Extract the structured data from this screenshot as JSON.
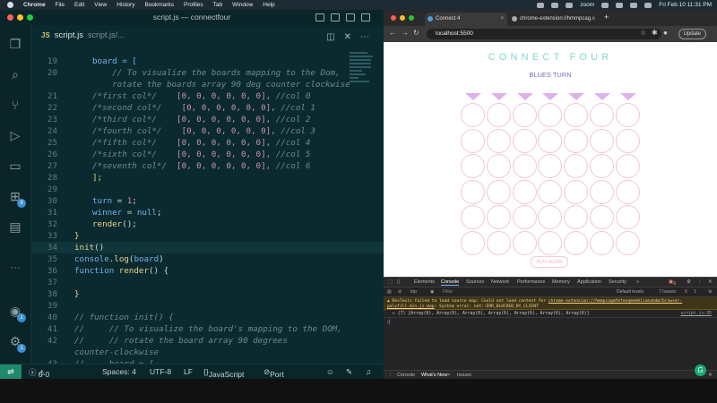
{
  "menubar": {
    "app": "Chrome",
    "items": [
      "File",
      "Edit",
      "View",
      "History",
      "Bookmarks",
      "Profiles",
      "Tab",
      "Window",
      "Help"
    ],
    "zoom": "zoom",
    "datetime": "Fri Feb 10  11:31 PM"
  },
  "vscode": {
    "title": "script.js — connectfour",
    "tab": {
      "icon": "JS",
      "name": "script.js",
      "path": "script.js/..."
    },
    "lines": [
      {
        "n": "19",
        "segs": [
          {
            "t": "board = [",
            "c": "vr"
          }
        ]
      },
      {
        "n": "20",
        "segs": [
          {
            "t": "    // To visualize the boards mapping to the Dom,",
            "c": "cm"
          }
        ]
      },
      {
        "n": "",
        "segs": [
          {
            "t": "    rotate the boards array 90 deg counter clockwise",
            "c": "cm"
          }
        ]
      },
      {
        "n": "21",
        "segs": [
          {
            "t": "/*first col*/    ",
            "c": "cm"
          },
          {
            "t": "[0, 0, 0, 0, 0, 0],",
            "c": "nm"
          },
          {
            "t": " //col 0",
            "c": "cm"
          }
        ]
      },
      {
        "n": "22",
        "segs": [
          {
            "t": "/*second col*/    ",
            "c": "cm"
          },
          {
            "t": "[0, 0, 0, 0, 0, 0],",
            "c": "nm"
          },
          {
            "t": " //col 1",
            "c": "cm"
          }
        ]
      },
      {
        "n": "23",
        "segs": [
          {
            "t": "/*third col*/    ",
            "c": "cm"
          },
          {
            "t": "[0, 0, 0, 0, 0, 0],",
            "c": "nm"
          },
          {
            "t": " //col 2",
            "c": "cm"
          }
        ]
      },
      {
        "n": "24",
        "segs": [
          {
            "t": "/*fourth col*/    ",
            "c": "cm"
          },
          {
            "t": "[0, 0, 0, 0, 0, 0],",
            "c": "nm"
          },
          {
            "t": " //col 3",
            "c": "cm"
          }
        ]
      },
      {
        "n": "25",
        "segs": [
          {
            "t": "/*fifth col*/    ",
            "c": "cm"
          },
          {
            "t": "[0, 0, 0, 0, 0, 0],",
            "c": "nm"
          },
          {
            "t": " //col 4",
            "c": "cm"
          }
        ]
      },
      {
        "n": "26",
        "segs": [
          {
            "t": "/*sixth col*/    ",
            "c": "cm"
          },
          {
            "t": "[0, 0, 0, 0, 0, 0],",
            "c": "nm"
          },
          {
            "t": " //col 5",
            "c": "cm"
          }
        ]
      },
      {
        "n": "27",
        "segs": [
          {
            "t": "/*seventh col*/  ",
            "c": "cm"
          },
          {
            "t": "[0, 0, 0, 0, 0, 0],",
            "c": "nm"
          },
          {
            "t": " //col 6",
            "c": "cm"
          }
        ]
      },
      {
        "n": "28",
        "segs": [
          {
            "t": "];",
            "c": "pn"
          }
        ]
      },
      {
        "n": "29",
        "segs": []
      },
      {
        "n": "30",
        "segs": [
          {
            "t": "turn",
            "c": "vr"
          },
          {
            "t": " = ",
            "c": ""
          },
          {
            "t": "1",
            "c": "nm"
          },
          {
            "t": ";",
            "c": ""
          }
        ]
      },
      {
        "n": "31",
        "segs": [
          {
            "t": "winner",
            "c": "vr"
          },
          {
            "t": " = ",
            "c": ""
          },
          {
            "t": "null",
            "c": "kw"
          },
          {
            "t": ";",
            "c": ""
          }
        ]
      },
      {
        "n": "32",
        "segs": [
          {
            "t": "render",
            "c": "fn"
          },
          {
            "t": "();",
            "c": ""
          }
        ]
      },
      {
        "n": "33",
        "segs": [
          {
            "t": "}",
            "c": "pn"
          }
        ]
      },
      {
        "n": "34",
        "segs": [
          {
            "t": "init",
            "c": "fn"
          },
          {
            "t": "()",
            "c": ""
          }
        ]
      },
      {
        "n": "35",
        "segs": [
          {
            "t": "console",
            "c": "vr"
          },
          {
            "t": ".",
            "c": ""
          },
          {
            "t": "log",
            "c": "fn"
          },
          {
            "t": "(",
            "c": ""
          },
          {
            "t": "board",
            "c": "vr"
          },
          {
            "t": ")",
            "c": ""
          }
        ]
      },
      {
        "n": "36",
        "segs": [
          {
            "t": "function ",
            "c": "kw"
          },
          {
            "t": "render",
            "c": "fn"
          },
          {
            "t": "() {",
            "c": ""
          }
        ]
      },
      {
        "n": "37",
        "segs": []
      },
      {
        "n": "38",
        "segs": [
          {
            "t": "}",
            "c": "pn"
          }
        ]
      },
      {
        "n": "39",
        "segs": []
      },
      {
        "n": "40",
        "segs": [
          {
            "t": "// function init() {",
            "c": "cm"
          }
        ]
      },
      {
        "n": "41",
        "segs": [
          {
            "t": "//     // To visualize the board's mapping to the DOM,",
            "c": "cm"
          }
        ]
      },
      {
        "n": "42",
        "segs": [
          {
            "t": "//     // rotate the board array 90 degrees",
            "c": "cm"
          }
        ]
      },
      {
        "n": "",
        "segs": [
          {
            "t": "counter-clockwise",
            "c": "cm"
          }
        ]
      },
      {
        "n": "43",
        "segs": [
          {
            "t": "//     board = [",
            "c": "cm"
          }
        ]
      }
    ],
    "status": {
      "errors": "0",
      "warnings": "0",
      "spaces": "Spaces: 4",
      "encoding": "UTF-8",
      "eol": "LF",
      "language": "JavaScript",
      "port": "Port : 5500"
    },
    "badges": {
      "extensions": "8",
      "accounts": "1",
      "settings": "1"
    }
  },
  "chrome": {
    "tabs": [
      {
        "title": "Connect 4"
      },
      {
        "title": "chrome-extension://hmmpcag..."
      }
    ],
    "url": "localhost:5500",
    "update": "Update",
    "game": {
      "title": "CONNECT FOUR",
      "turn": "BLUES TURN",
      "play_again": "PLAY AGAIN",
      "columns": 7,
      "rows": 6
    },
    "devtools": {
      "tabs": [
        "Elements",
        "Console",
        "Sources",
        "Network",
        "Performance",
        "Memory",
        "Application",
        "Security"
      ],
      "active": "Console",
      "filter": {
        "context": "top",
        "placeholder": "Filter",
        "levels": "Default levels",
        "issues": "7 Issues:"
      },
      "warning": {
        "text": "DevTools failed to load source map: Could not load content for ",
        "link": "chrome-extension://hmmpcagmfmfoeqmemhiinmahdm/browser-polyfill.min.js.map",
        "rest": ": System error: net::ERR_BLOCKED_BY_CLIENT"
      },
      "log": {
        "text": "▸ (7) [Array(6), Array(6), Array(6), Array(6), Array(6), Array(6), Array(6)]",
        "source": "script.js:35"
      },
      "drawer": [
        "Console",
        "What's New",
        "Issues"
      ],
      "counts": {
        "warn": "6",
        "info": "1"
      }
    }
  }
}
